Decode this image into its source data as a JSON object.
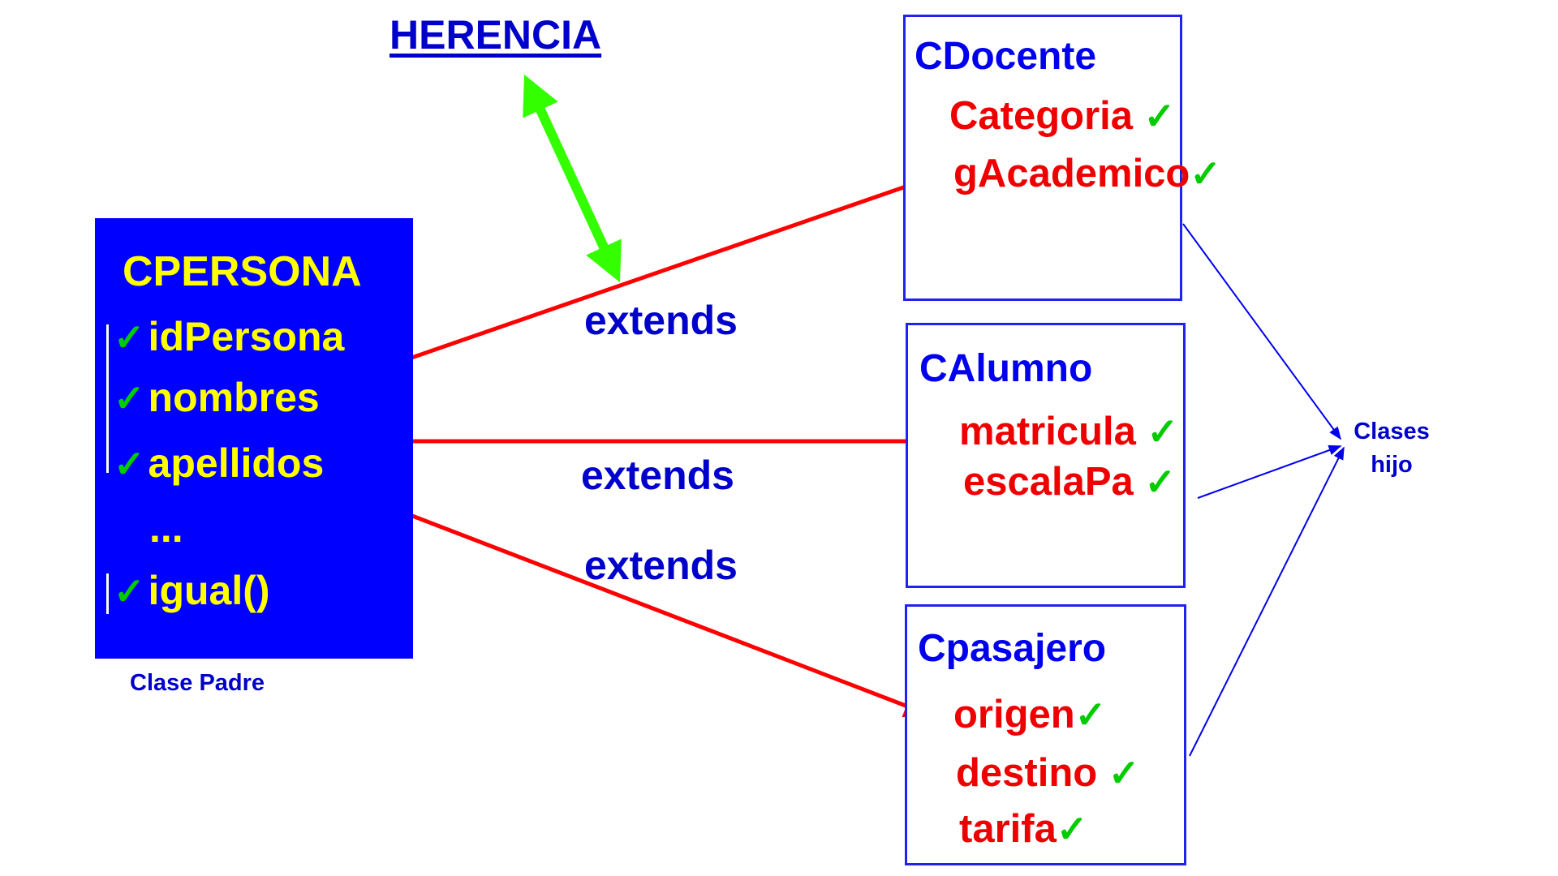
{
  "title": "HERENCIA",
  "parent": {
    "name": "CPERSONA",
    "attributes": [
      "idPersona",
      "nombres",
      "apellidos",
      "...",
      "igual()"
    ],
    "caption": "Clase Padre"
  },
  "relation_label": "extends",
  "children": [
    {
      "name": "CDocente",
      "attributes": [
        "Categoria",
        "gAcademico"
      ]
    },
    {
      "name": "CAlumno",
      "attributes": [
        "matricula",
        "escalaPa"
      ]
    },
    {
      "name": "Cpasajero",
      "attributes": [
        "origen",
        "destino",
        "tarifa"
      ]
    }
  ],
  "children_caption": "Clases hijo",
  "check_glyph": "✓",
  "colors": {
    "parent_fill": "#0000ff",
    "parent_text": "#ffff00",
    "child_attr_text": "#ee0000",
    "class_name_text": "#0000ee",
    "extends_arrow": "#ff0000",
    "herencia_arrow": "#33ff00",
    "check": "#00cc00"
  }
}
